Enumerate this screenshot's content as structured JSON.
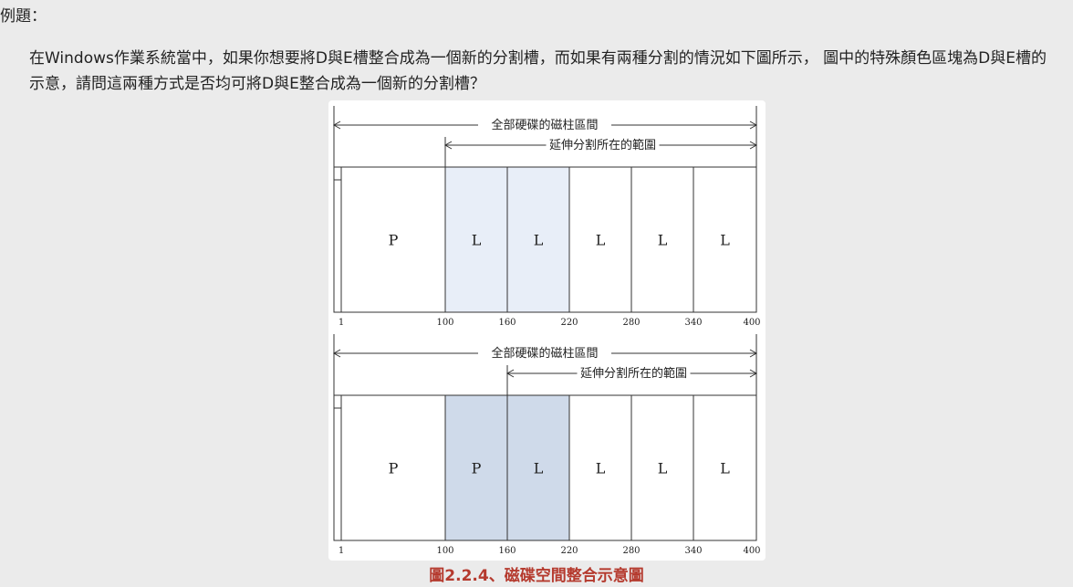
{
  "heading": "例題：",
  "question": "在Windows作業系統當中，如果你想要將D與E槽整合成為一個新的分割槽，而如果有兩種分割的情況如下圖所示， 圖中的特殊顏色區塊為D與E槽的示意，請問這兩種方式是否均可將D與E整合成為一個新的分割槽？",
  "caption": "圖2.2.4、磁碟空間整合示意圖",
  "colors": {
    "light_highlight": "#e8eef8",
    "dark_highlight": "#cfdaea",
    "caption": "#b53a2e"
  },
  "diagrams": [
    {
      "total_label": "全部硬碟的磁柱區間",
      "extended_label": "延伸分割所在的範圍",
      "extended_start": 100,
      "cells": [
        {
          "label": "P",
          "start": 1,
          "end": 100,
          "highlight": "none"
        },
        {
          "label": "L",
          "start": 100,
          "end": 160,
          "highlight": "light"
        },
        {
          "label": "L",
          "start": 160,
          "end": 220,
          "highlight": "light"
        },
        {
          "label": "L",
          "start": 220,
          "end": 280,
          "highlight": "none"
        },
        {
          "label": "L",
          "start": 280,
          "end": 340,
          "highlight": "none"
        },
        {
          "label": "L",
          "start": 340,
          "end": 400,
          "highlight": "none"
        }
      ],
      "ticks": [
        "1",
        "100",
        "160",
        "220",
        "280",
        "340",
        "400"
      ]
    },
    {
      "total_label": "全部硬碟的磁柱區間",
      "extended_label": "延伸分割所在的範圍",
      "extended_start": 160,
      "cells": [
        {
          "label": "P",
          "start": 1,
          "end": 100,
          "highlight": "none"
        },
        {
          "label": "P",
          "start": 100,
          "end": 160,
          "highlight": "dark"
        },
        {
          "label": "L",
          "start": 160,
          "end": 220,
          "highlight": "dark"
        },
        {
          "label": "L",
          "start": 220,
          "end": 280,
          "highlight": "none"
        },
        {
          "label": "L",
          "start": 280,
          "end": 340,
          "highlight": "none"
        },
        {
          "label": "L",
          "start": 340,
          "end": 400,
          "highlight": "none"
        }
      ],
      "ticks": [
        "1",
        "100",
        "160",
        "220",
        "280",
        "340",
        "400"
      ]
    }
  ]
}
